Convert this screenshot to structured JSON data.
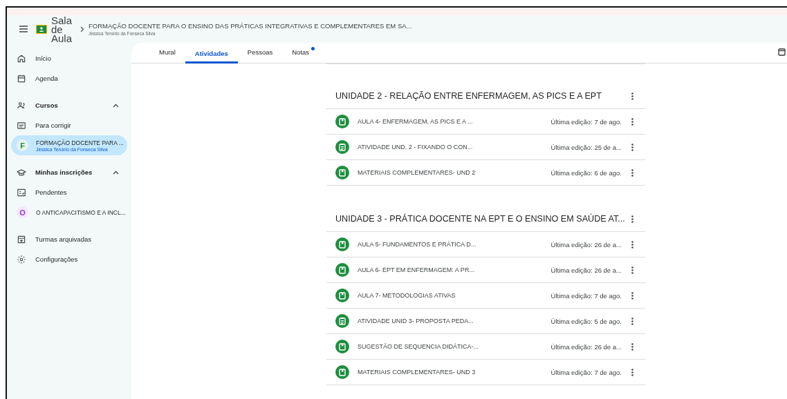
{
  "app": {
    "name": "Sala de Aula"
  },
  "course": {
    "title": "FORMAÇÃO DOCENTE PARA O ENSINO DAS PRÁTICAS INTEGRATIVAS E COMPLEMENTARES EM SA...",
    "teacher": "Jéssica Tenório da Fonseca Silva"
  },
  "sidebar": {
    "items": [
      {
        "kind": "link",
        "label": "Início",
        "selected": false
      },
      {
        "kind": "link",
        "label": "Agenda",
        "selected": false
      },
      {
        "kind": "section",
        "label": "Cursos",
        "expanded": true
      },
      {
        "kind": "link",
        "label": "Para corrigir",
        "selected": false
      },
      {
        "kind": "course",
        "avatar": "F",
        "color": "#1e8e3e",
        "label": "FORMAÇÃO DOCENTE PARA ...",
        "subtitle": "Jéssica Tenório da Fonseca Silva",
        "selected": true
      },
      {
        "kind": "section",
        "label": "Minhas inscrições",
        "expanded": true
      },
      {
        "kind": "link",
        "label": "Pendentes",
        "selected": false
      },
      {
        "kind": "course",
        "avatar": "O",
        "color": "#9334e6",
        "label": "O ANTICAPACITISMO E A INCL...",
        "selected": false
      },
      {
        "kind": "link",
        "label": "Turmas arquivadas",
        "selected": false
      },
      {
        "kind": "link",
        "label": "Configurações",
        "selected": false
      }
    ]
  },
  "tabs": [
    {
      "label": "Mural",
      "selected": false,
      "notification": false
    },
    {
      "label": "Atividades",
      "selected": true,
      "notification": false
    },
    {
      "label": "Pessoas",
      "selected": false,
      "notification": false
    },
    {
      "label": "Notas",
      "selected": false,
      "notification": true
    }
  ],
  "topics": [
    {
      "title": "UNIDADE 2 - RELAÇÃO ENTRE ENFERMAGEM, AS PICS E A EPT",
      "items": [
        {
          "kind": "material",
          "title": "AULA 4- ENFERMAGEM, AS PICS E A ...",
          "edited": "Última edição: 7 de ago."
        },
        {
          "kind": "assignment",
          "title": "ATIVIDADE UND. 2 - FIXANDO O CON...",
          "edited": "Última edição: 25 de a..."
        },
        {
          "kind": "material",
          "title": "MATERIAIS COMPLEMENTARES- UND 2",
          "edited": "Última edição: 6 de ago."
        }
      ]
    },
    {
      "title": "UNIDADE 3 - PRÁTICA DOCENTE NA EPT E O ENSINO EM SAÚDE AT...",
      "items": [
        {
          "kind": "material",
          "title": "AULA 5- FUNDAMENTOS E PRÁTICA D...",
          "edited": "Última edição: 26 de a..."
        },
        {
          "kind": "material",
          "title": "AULA 6- EPT EM ENFERMAGEM: A PR...",
          "edited": "Última edição: 26 de a..."
        },
        {
          "kind": "material",
          "title": "AULA 7- METODOLOGIAS ATIVAS",
          "edited": "Última edição: 7 de ago."
        },
        {
          "kind": "assignment",
          "title": "ATIVIDADE UNID 3- PROPOSTA PEDA...",
          "edited": "Última edição: 5 de ago."
        },
        {
          "kind": "material",
          "title": "SUGESTÃO DE SEQUENCIA DIDÁTICA-...",
          "edited": "Última edição: 26 de a..."
        },
        {
          "kind": "material",
          "title": "MATERIAIS COMPLEMENTARES- UND 3",
          "edited": "Última edição: 7 de ago."
        }
      ]
    }
  ]
}
